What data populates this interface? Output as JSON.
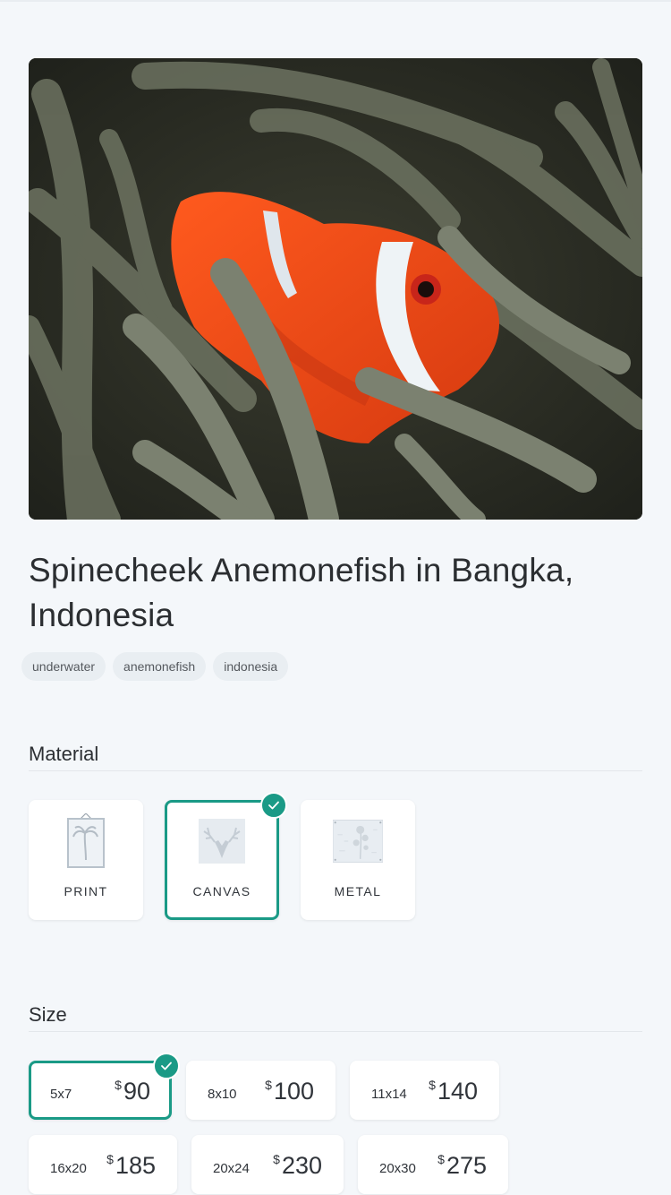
{
  "product": {
    "title": "Spinecheek Anemonefish in Bangka, Indonesia",
    "image_subject": "clownfish-in-anemone",
    "tags": [
      "underwater",
      "anemonefish",
      "indonesia"
    ]
  },
  "material": {
    "heading": "Material",
    "options": [
      {
        "label": "PRINT",
        "icon": "framed-palm-print-icon",
        "selected": false
      },
      {
        "label": "CANVAS",
        "icon": "deer-canvas-icon",
        "selected": true
      },
      {
        "label": "METAL",
        "icon": "metal-floral-icon",
        "selected": false
      }
    ]
  },
  "size": {
    "heading": "Size",
    "currency": "$",
    "options": [
      {
        "dims": "5x7",
        "price": "90",
        "selected": true
      },
      {
        "dims": "8x10",
        "price": "100",
        "selected": false
      },
      {
        "dims": "11x14",
        "price": "140",
        "selected": false
      },
      {
        "dims": "16x20",
        "price": "185",
        "selected": false
      },
      {
        "dims": "20x24",
        "price": "230",
        "selected": false
      },
      {
        "dims": "20x30",
        "price": "275",
        "selected": false
      }
    ]
  },
  "colors": {
    "accent": "#1a9a86",
    "background": "#f4f7fa",
    "fish": "#f0521d"
  }
}
